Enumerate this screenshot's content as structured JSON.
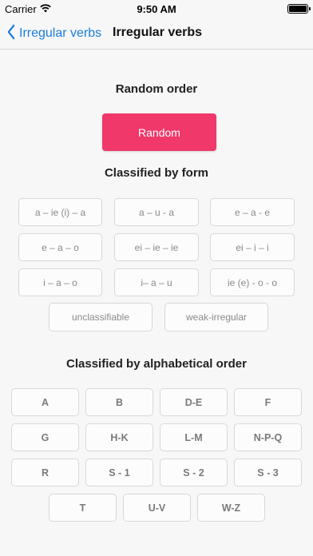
{
  "status": {
    "carrier": "Carrier",
    "time": "9:50 AM",
    "wifi_icon": "wifi-icon",
    "battery_icon": "battery-icon"
  },
  "nav": {
    "back_label": "Irregular verbs",
    "title": "Irregular verbs",
    "back_icon": "chevron-left-icon"
  },
  "sections": {
    "random_title": "Random order",
    "random_button": "Random",
    "form_title": "Classified by form",
    "alpha_title": "Classified by alphabetical order"
  },
  "form_buttons": [
    "a – ie (i) – a",
    "a – u - a",
    "e – a - e",
    "e – a – o",
    "ei – ie – ie",
    "ei – i – i",
    "i – a – o",
    "i– a – u",
    "ie (e) - o - o",
    "unclassifiable",
    "weak-irregular"
  ],
  "alpha_buttons": [
    "A",
    "B",
    "D-E",
    "F",
    "G",
    "H-K",
    "L-M",
    "N-P-Q",
    "R",
    "S - 1",
    "S - 2",
    "S - 3",
    "T",
    "U-V",
    "W-Z"
  ],
  "colors": {
    "accent": "#f0386b",
    "link": "#1a7de0",
    "background": "#f7f7f7"
  }
}
